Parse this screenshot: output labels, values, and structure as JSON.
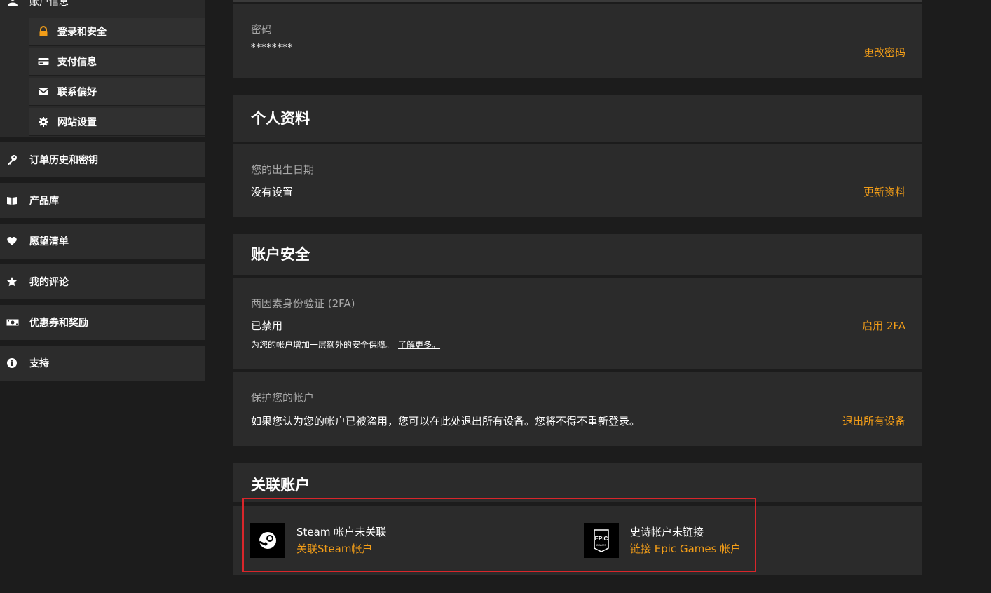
{
  "sidebar": {
    "top_label": "账户信息",
    "sub_items": [
      {
        "label": "登录和安全",
        "icon": "lock-icon",
        "active": true
      },
      {
        "label": "支付信息",
        "icon": "credit-card-icon"
      },
      {
        "label": "联系偏好",
        "icon": "envelope-icon"
      },
      {
        "label": "网站设置",
        "icon": "gear-icon"
      }
    ],
    "items": [
      {
        "label": "订单历史和密钥",
        "icon": "key-icon"
      },
      {
        "label": "产品库",
        "icon": "book-icon"
      },
      {
        "label": "愿望清单",
        "icon": "heart-icon"
      },
      {
        "label": "我的评论",
        "icon": "star-icon"
      },
      {
        "label": "优惠券和奖励",
        "icon": "money-icon"
      },
      {
        "label": "支持",
        "icon": "info-icon"
      }
    ]
  },
  "password": {
    "label": "密码",
    "value": "********",
    "action": "更改密码"
  },
  "profile": {
    "title": "个人资料",
    "birth_label": "您的出生日期",
    "birth_value": "没有设置",
    "action": "更新资料"
  },
  "security": {
    "title": "账户安全",
    "twofa_label": "两因素身份验证 (2FA)",
    "twofa_status": "已禁用",
    "twofa_note": "为您的帐户增加一层额外的安全保障。",
    "twofa_learn_more": "了解更多。",
    "twofa_action": "启用 2FA",
    "protect_label": "保护您的帐户",
    "protect_text": "如果您认为您的帐户已被盗用，您可以在此处退出所有设备。您将不得不重新登录。",
    "protect_action": "退出所有设备"
  },
  "linked": {
    "title": "关联账户",
    "steam": {
      "status": "Steam 帐户未关联",
      "link": "关联Steam帐户",
      "icon": "steam-logo-icon"
    },
    "epic": {
      "status": "史诗帐户未链接",
      "link": "链接 Epic Games 帐户",
      "icon": "epic-games-logo-icon",
      "logo_text_1": "EPIC",
      "logo_text_2": "GAMES"
    }
  },
  "colors": {
    "accent": "#f29d18",
    "highlight_box": "#d9262b",
    "background": "#1c1c1c",
    "card": "#2b2b2b"
  }
}
